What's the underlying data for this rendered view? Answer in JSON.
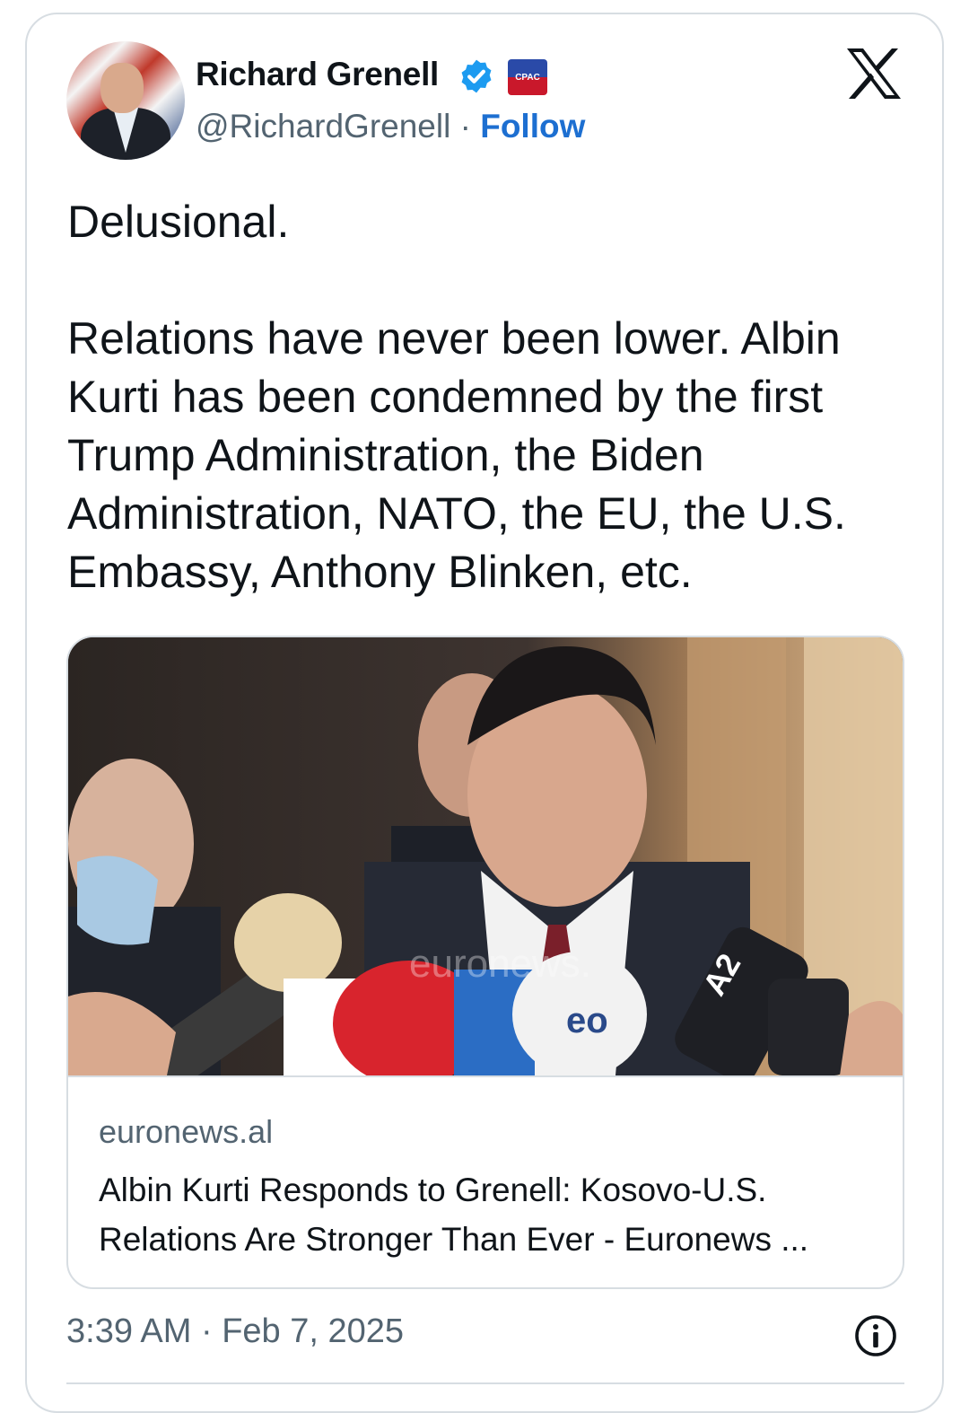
{
  "author": {
    "name": "Richard Grenell",
    "handle": "@RichardGrenell",
    "separator": "·",
    "follow_label": "Follow",
    "badge_text": "CPAC"
  },
  "tweet": {
    "text": "Delusional.\n\nRelations have never been lower. Albin Kurti has been condemned by the first Trump Administration, the Biden Administration, NATO, the EU, the U.S. Embassy, Anthony Blinken, etc."
  },
  "link_card": {
    "watermark": "euronews.",
    "domain": "euronews.al",
    "headline": "Albin Kurti Responds to Grenell: Kosovo-U.S. Relations Are Stronger Than Ever - Euronews ..."
  },
  "footer": {
    "timestamp": "3:39 AM · Feb 7, 2025"
  },
  "colors": {
    "follow": "#1d6fd1",
    "verified": "#1d9bf0",
    "muted": "#536471",
    "border": "#d7dde2"
  },
  "icons": [
    "verified-badge-icon",
    "cpac-badge-icon",
    "x-logo-icon",
    "info-icon"
  ]
}
